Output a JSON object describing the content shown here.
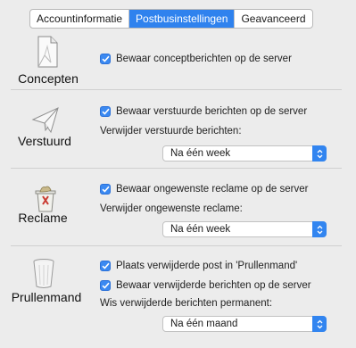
{
  "tabs": [
    {
      "label": "Accountinformatie"
    },
    {
      "label": "Postbusinstellingen"
    },
    {
      "label": "Geavanceerd"
    }
  ],
  "sections": {
    "drafts": {
      "title": "Concepten",
      "icon": "draft-document-icon",
      "checkbox_label": "Bewaar conceptberichten op de server",
      "checked": true
    },
    "sent": {
      "title": "Verstuurd",
      "icon": "paper-plane-icon",
      "checkbox_label": "Bewaar verstuurde berichten op de server",
      "checked": true,
      "delete_label": "Verwijder verstuurde berichten:",
      "delete_value": "Na één week"
    },
    "junk": {
      "title": "Reclame",
      "icon": "junk-bin-icon",
      "checkbox_label": "Bewaar ongewenste reclame op de server",
      "checked": true,
      "delete_label": "Verwijder ongewenste reclame:",
      "delete_value": "Na één week"
    },
    "trash": {
      "title": "Prullenmand",
      "icon": "trash-can-icon",
      "checkbox_label_1": "Plaats verwijderde post in 'Prullenmand'",
      "checked_1": true,
      "checkbox_label_2": "Bewaar verwijderde berichten op de server",
      "checked_2": true,
      "delete_label": "Wis verwijderde berichten permanent:",
      "delete_value": "Na één maand"
    }
  },
  "colors": {
    "accent": "#2f82ee",
    "background": "#ececec"
  }
}
